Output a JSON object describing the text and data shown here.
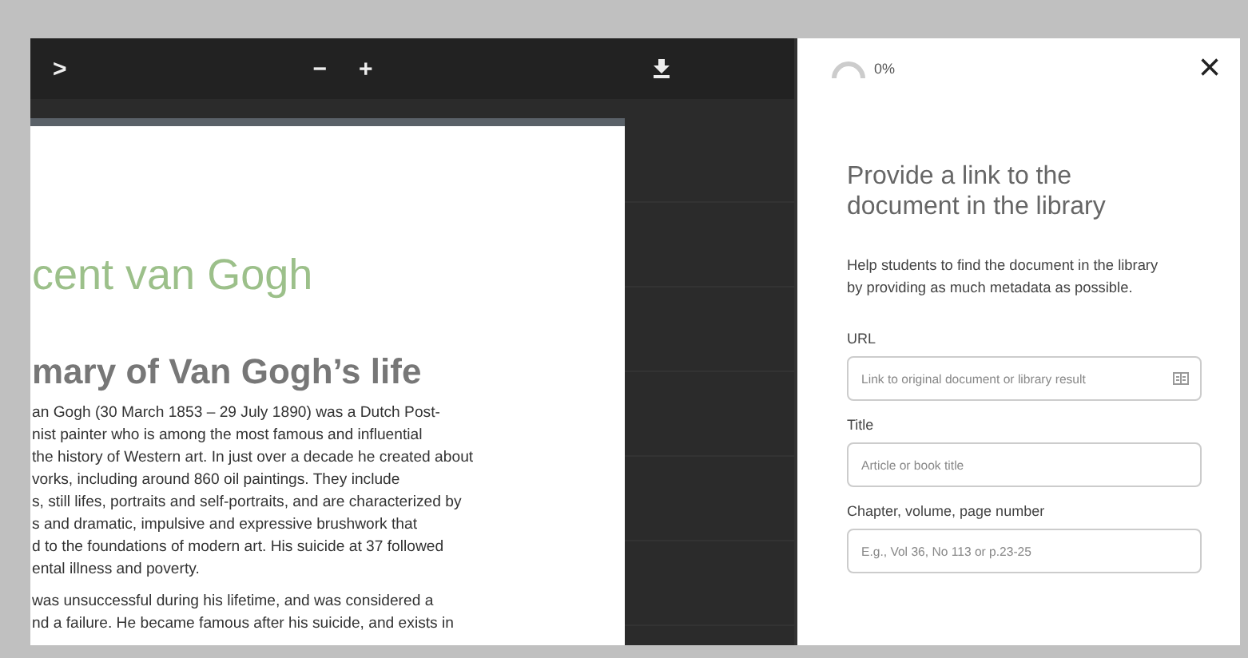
{
  "viewer": {
    "toolbar": {
      "next": ">",
      "zoom_out": "−",
      "zoom_in": "+"
    },
    "document": {
      "title": "cent van Gogh",
      "heading": "mary of Van Gogh’s life",
      "paragraphs": [
        [
          "an Gogh (30 March 1853 – 29 July 1890) was a Dutch Post-",
          "nist painter who is among the most famous and influential",
          "the history of Western art. In just over a decade he created about",
          "vorks, including around 860 oil paintings. They include",
          "s, still lifes, portraits and self-portraits, and are characterized by",
          "s and dramatic, impulsive and expressive brushwork that",
          "d to the foundations of modern art. His suicide at 37 followed",
          "ental illness and poverty."
        ],
        [
          "was unsuccessful during his lifetime, and was considered a",
          "nd a failure. He became famous after his suicide, and exists in"
        ]
      ]
    }
  },
  "panel": {
    "progress": {
      "reading": "0%"
    },
    "close": "×",
    "title": "Provide a link to the document in the library",
    "help": "Help students to find the document in the library by providing as much metadata as possible.",
    "fields": [
      {
        "kind": "url",
        "label": "URL",
        "placeholder": "Link to original document or library result"
      },
      {
        "kind": "text",
        "label": "Title",
        "placeholder": "Article or book title"
      },
      {
        "kind": "text",
        "label": "Chapter, volume, page number",
        "placeholder": "E.g., Vol 36, No 113 or p.23-25"
      }
    ]
  }
}
